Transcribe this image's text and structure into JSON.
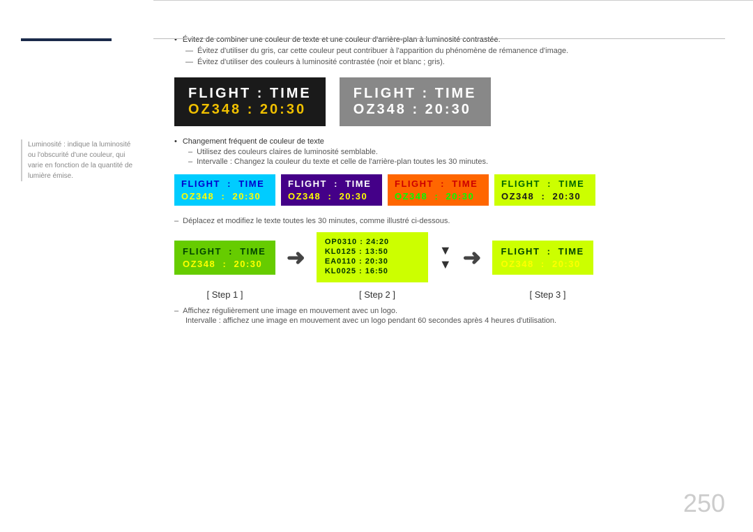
{
  "sidebar": {
    "note": "Luminosité : indique la luminosité ou l'obscurité d'une couleur, qui varie en fonction de la quantité de lumière émise."
  },
  "bullets": {
    "b1": "Évitez de combiner une couleur de texte et une couleur d'arrière-plan à luminosité contrastée.",
    "b2": "Évitez d'utiliser du gris, car cette couleur peut contribuer à l'apparition du phénomène de rémanence d'image.",
    "b3": "Évitez d'utiliser des couleurs à luminosité contrastée (noir et blanc ; gris)."
  },
  "cards": {
    "card1_row1": "FLIGHT  :  TIME",
    "card1_row2": "OZ348  :  20:30",
    "card2_row1": "FLIGHT  :  TIME",
    "card2_row2": "OZ348  :  20:30"
  },
  "color_section": {
    "change_text": "Changement fréquent de couleur de texte",
    "sub1": "Utilisez des couleurs claires de luminosité semblable.",
    "sub2": "Intervalle : Changez la couleur du texte et celle de l'arrière-plan toutes les 30 minutes.",
    "cards": [
      {
        "r1": "FLIGHT  :  TIME",
        "r2": "OZ348  :  20:30"
      },
      {
        "r1": "FLIGHT  :  TIME",
        "r2": "OZ348  :  20:30"
      },
      {
        "r1": "FLIGHT  :  TIME",
        "r2": "OZ348  :  20:30"
      },
      {
        "r1": "FLIGHT  :  TIME",
        "r2": "OZ348  :  20:30"
      }
    ]
  },
  "move_section": {
    "dash": "Déplacez et modifiez le texte toutes les 30 minutes, comme illustré ci-dessous.",
    "step1_r1": "FLIGHT  :  TIME",
    "step1_r2": "OZ348  :  20:30",
    "step2_r1": "OP0310 : 24:20",
    "step2_r2": "KL0125 : 13:50",
    "step2_r3": "EA0110 : 20:30",
    "step2_r4": "KL0025 : 16:50",
    "step3_r1": "FLIGHT  :  TIME",
    "step3_r2": "OZ348  :  20:30",
    "step1_label": "[ Step 1 ]",
    "step2_label": "[ Step 2 ]",
    "step3_label": "[ Step 3 ]"
  },
  "bottom_notes": {
    "n1": "Affichez régulièrement une image en mouvement avec un logo.",
    "n2": "Intervalle : affichez une image en mouvement avec un logo pendant 60 secondes après 4 heures d'utilisation."
  },
  "page_number": "250"
}
